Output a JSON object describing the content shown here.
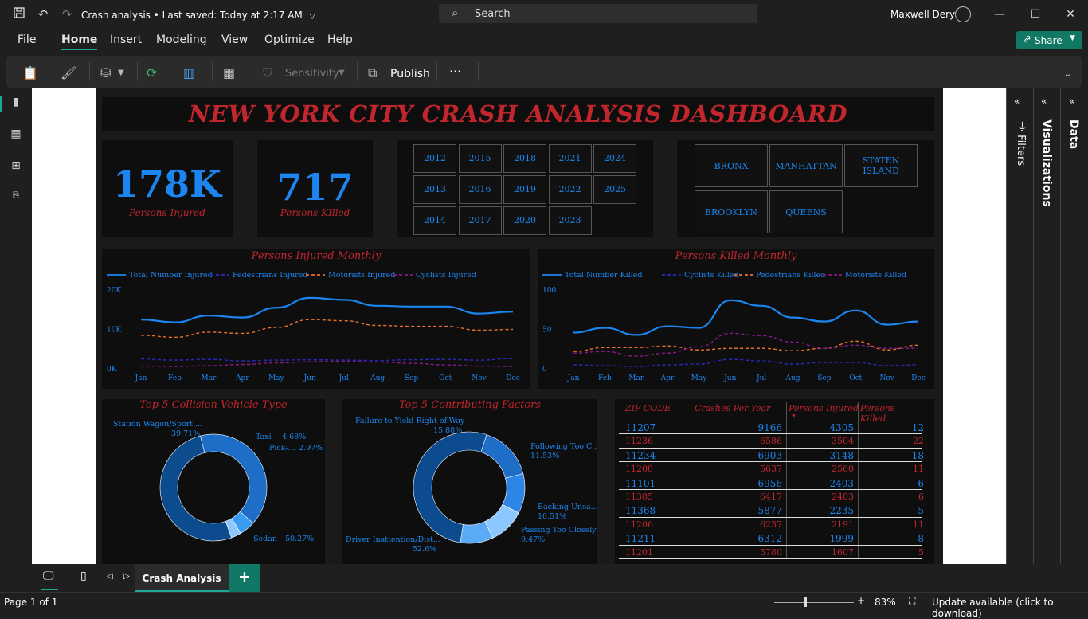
{
  "app": {
    "doc_title": "Crash analysis",
    "saved": "Last saved: Today at 2:17 AM",
    "search_placeholder": "Search",
    "user": "Maxwell Dery",
    "menu": [
      "File",
      "Home",
      "Insert",
      "Modeling",
      "View",
      "Optimize",
      "Help"
    ],
    "share_label": "Share",
    "ribbon": {
      "sensitivity": "Sensitivity",
      "publish": "Publish",
      "more": "···"
    },
    "right_tabs": {
      "filters": "Filters",
      "visualizations": "Visualizations",
      "data": "Data"
    },
    "page_tab": "Crash Analysis",
    "add_page": "+",
    "status_page": "Page 1 of 1",
    "zoom": "83%",
    "update": "Update available (click to download)"
  },
  "dashboard": {
    "title": "NEW YORK CITY CRASH ANALYSIS DASHBOARD",
    "kpi_injured": {
      "value": "178K",
      "label": "Persons Injured"
    },
    "kpi_killed": {
      "value": "717",
      "label": "Persons KIlled"
    },
    "years": [
      "2012",
      "2015",
      "2018",
      "2021",
      "2024",
      "2013",
      "2016",
      "2019",
      "2022",
      "2025",
      "2014",
      "2017",
      "2020",
      "2023"
    ],
    "boroughs": [
      "BRONX",
      "MANHATTAN",
      "STATEN ISLAND",
      "BROOKLYN",
      "QUEENS"
    ],
    "colors": {
      "accent": "#1b86f0",
      "red": "#c0262c",
      "orange": "#e8702a",
      "purple": "#8a1a8a",
      "navy": "#2a2ac0"
    }
  },
  "chart_data": [
    {
      "type": "line",
      "title": "Persons Injured Monthly",
      "categories": [
        "Jan",
        "Feb",
        "Mar",
        "Apr",
        "May",
        "Jun",
        "Jul",
        "Aug",
        "Sep",
        "Oct",
        "Nov",
        "Dec"
      ],
      "yticks": [
        "0K",
        "10K",
        "20K"
      ],
      "ylim": [
        0,
        20000
      ],
      "series": [
        {
          "name": "Total Number Injured",
          "values": [
            12500,
            11800,
            13500,
            13000,
            15500,
            18000,
            17500,
            16000,
            15800,
            15800,
            14000,
            14500
          ]
        },
        {
          "name": "Pedestrians Injured",
          "values": [
            2500,
            2200,
            2400,
            2000,
            2200,
            2300,
            2200,
            2100,
            2300,
            2400,
            2200,
            2600
          ]
        },
        {
          "name": "Motorists Injured",
          "values": [
            8500,
            8000,
            9300,
            9000,
            10500,
            12500,
            12200,
            11000,
            10800,
            10800,
            9800,
            10000
          ]
        },
        {
          "name": "Cyclists Injured",
          "values": [
            700,
            600,
            800,
            1100,
            1500,
            1800,
            1900,
            1700,
            1400,
            1000,
            700,
            600
          ]
        }
      ]
    },
    {
      "type": "line",
      "title": "Persons Killed Monthly",
      "categories": [
        "Jan",
        "Feb",
        "Mar",
        "Apr",
        "May",
        "Jun",
        "Jul",
        "Aug",
        "Sep",
        "Oct",
        "Nov",
        "Dec"
      ],
      "yticks": [
        "0",
        "50",
        "100"
      ],
      "ylim": [
        0,
        100
      ],
      "series": [
        {
          "name": "Total Number Killed",
          "values": [
            46,
            52,
            43,
            54,
            52,
            87,
            80,
            65,
            60,
            74,
            56,
            60
          ]
        },
        {
          "name": "Cyclists Killed",
          "values": [
            5,
            4,
            3,
            5,
            6,
            12,
            10,
            6,
            8,
            8,
            4,
            5
          ]
        },
        {
          "name": "Pedestrians Killed",
          "values": [
            22,
            27,
            27,
            29,
            24,
            26,
            26,
            23,
            26,
            35,
            24,
            30
          ]
        },
        {
          "name": "Motorists Killed",
          "values": [
            20,
            22,
            16,
            20,
            28,
            45,
            42,
            34,
            26,
            30,
            26,
            26
          ]
        }
      ]
    },
    {
      "type": "pie",
      "title": "Top 5 Collision Vehicle Type",
      "categories": [
        "Station Wagon/Sport ...",
        "Taxi",
        "Pick-...",
        "Sedan"
      ],
      "values": [
        39.71,
        4.68,
        2.97,
        50.27
      ],
      "labels": [
        "39.71%",
        "4.68%",
        "2.97%",
        "50.27%"
      ]
    },
    {
      "type": "pie",
      "title": "Top 5 Contributing Factors",
      "categories": [
        "Driver Inattention/Dist...",
        "Failure to Yield Right-of-Way",
        "Following Too C...",
        "Backing Unsa...",
        "Passing Too Closely"
      ],
      "values": [
        52.6,
        15.88,
        11.53,
        10.51,
        9.47
      ],
      "labels": [
        "52.6%",
        "15.88%",
        "11.53%",
        "10.51%",
        "9.47%"
      ]
    },
    {
      "type": "table",
      "columns": [
        "ZIP CODE",
        "Crashes Per Year",
        "Persons Injured",
        "Persons Killed"
      ],
      "rows": [
        [
          "11207",
          "9166",
          "4305",
          "12"
        ],
        [
          "11236",
          "6586",
          "3504",
          "22"
        ],
        [
          "11234",
          "6903",
          "3148",
          "18"
        ],
        [
          "11208",
          "5637",
          "2560",
          "11"
        ],
        [
          "11101",
          "6956",
          "2403",
          "6"
        ],
        [
          "11385",
          "6417",
          "2403",
          "6"
        ],
        [
          "11368",
          "5877",
          "2235",
          "5"
        ],
        [
          "11206",
          "6237",
          "2191",
          "11"
        ],
        [
          "11211",
          "6312",
          "1999",
          "8"
        ],
        [
          "11201",
          "5780",
          "1607",
          "5"
        ]
      ]
    }
  ]
}
